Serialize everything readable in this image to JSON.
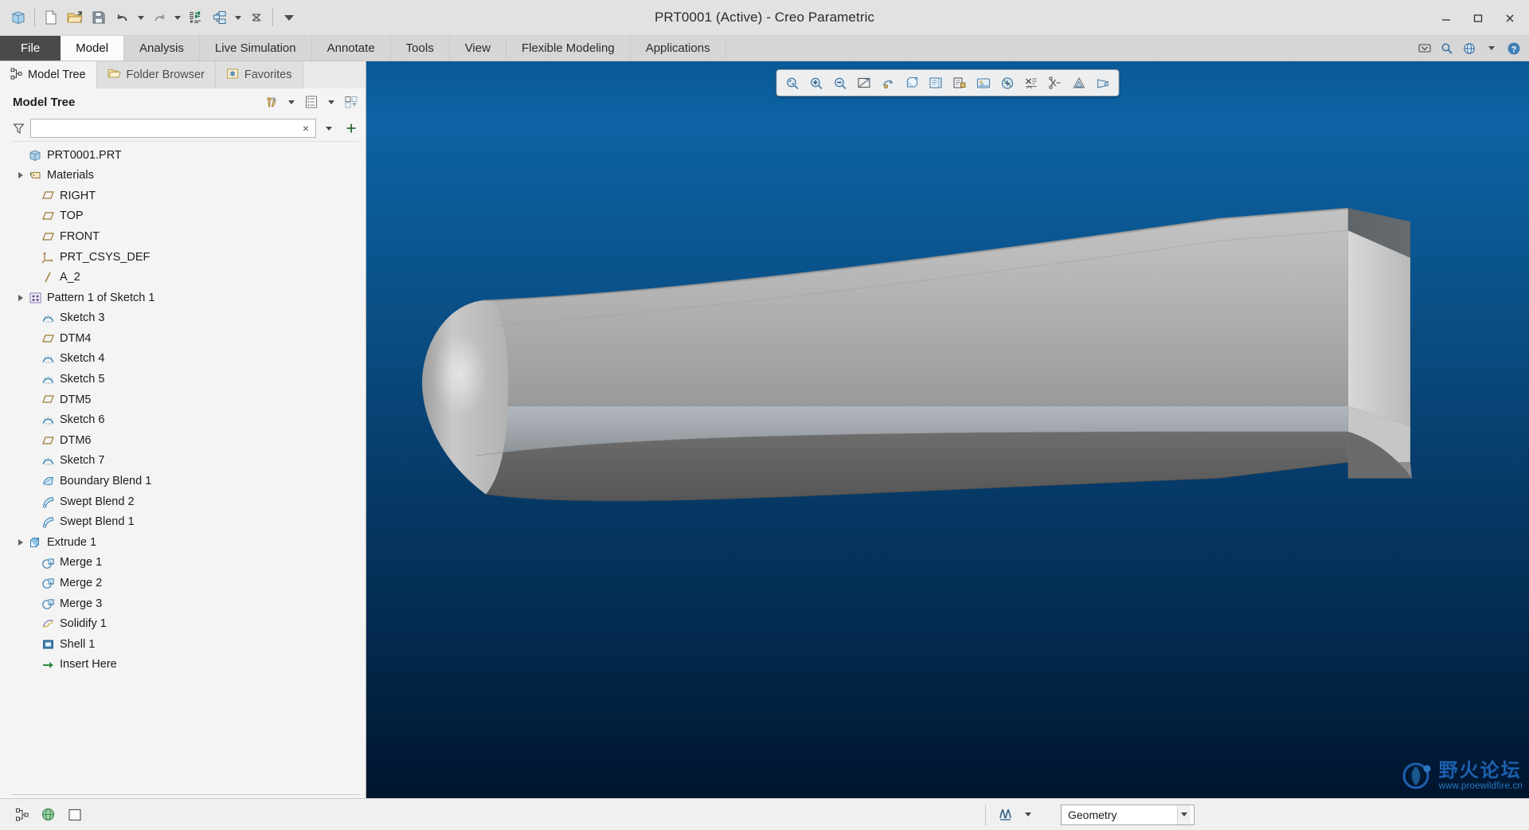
{
  "window": {
    "title": "PRT0001 (Active) - Creo Parametric",
    "minimize_label": "Minimize",
    "maximize_label": "Restore",
    "close_label": "Close"
  },
  "quick_access": {
    "items": [
      {
        "name": "app-icon",
        "label": "Creo Parametric"
      },
      {
        "name": "new-icon",
        "label": "New"
      },
      {
        "name": "open-icon",
        "label": "Open"
      },
      {
        "name": "save-icon",
        "label": "Save"
      },
      {
        "name": "undo-icon",
        "label": "Undo"
      },
      {
        "name": "redo-icon",
        "label": "Redo"
      },
      {
        "name": "regenerate-icon",
        "label": "Regenerate"
      },
      {
        "name": "window-switch-icon",
        "label": "Close Window"
      },
      {
        "name": "close-window-icon",
        "label": "Close"
      },
      {
        "name": "customize-icon",
        "label": "Customize Quick Access Toolbar"
      }
    ]
  },
  "ribbon": {
    "tabs": [
      {
        "label": "File",
        "active": false,
        "file": true
      },
      {
        "label": "Model",
        "active": true,
        "file": false
      },
      {
        "label": "Analysis",
        "active": false,
        "file": false
      },
      {
        "label": "Live Simulation",
        "active": false,
        "file": false
      },
      {
        "label": "Annotate",
        "active": false,
        "file": false
      },
      {
        "label": "Tools",
        "active": false,
        "file": false
      },
      {
        "label": "View",
        "active": false,
        "file": false
      },
      {
        "label": "Flexible Modeling",
        "active": false,
        "file": false
      },
      {
        "label": "Applications",
        "active": false,
        "file": false
      }
    ],
    "right_buttons": [
      {
        "name": "minimize-ribbon-icon",
        "label": "Minimize the Ribbon"
      },
      {
        "name": "search-icon",
        "label": "Search"
      },
      {
        "name": "help-center-icon",
        "label": "Help Center"
      },
      {
        "name": "help-dropdown-icon",
        "label": "Help Options"
      },
      {
        "name": "help-icon",
        "label": "Help"
      }
    ]
  },
  "navigator": {
    "tabs": [
      {
        "label": "Model Tree",
        "icon": "model-tree-icon",
        "active": true
      },
      {
        "label": "Folder Browser",
        "icon": "folder-browser-icon",
        "active": false
      },
      {
        "label": "Favorites",
        "icon": "favorites-icon",
        "active": false
      }
    ],
    "panel_title": "Model Tree",
    "tool_buttons": [
      {
        "name": "settings-tools-icon",
        "label": "Settings"
      },
      {
        "name": "settings-dropdown-icon",
        "label": "Settings Menu"
      },
      {
        "name": "tree-columns-icon",
        "label": "Show Tree Columns"
      },
      {
        "name": "tree-columns-dropdown-icon",
        "label": "Tree Columns Menu"
      },
      {
        "name": "tree-filters-icon",
        "label": "Tree Filters"
      }
    ],
    "filter": {
      "value": "",
      "placeholder": "",
      "clear_label": "×",
      "funnel_icon": "filter-funnel-icon",
      "dropdown_label": "Search Options",
      "add_label": "+"
    },
    "tree": [
      {
        "label": "PRT0001.PRT",
        "icon": "part-icon",
        "indent": 0,
        "expandable": false
      },
      {
        "label": "Materials",
        "icon": "materials-icon",
        "indent": 0,
        "expandable": true
      },
      {
        "label": "RIGHT",
        "icon": "datum-plane-icon",
        "indent": 1,
        "expandable": false
      },
      {
        "label": "TOP",
        "icon": "datum-plane-icon",
        "indent": 1,
        "expandable": false
      },
      {
        "label": "FRONT",
        "icon": "datum-plane-icon",
        "indent": 1,
        "expandable": false
      },
      {
        "label": "PRT_CSYS_DEF",
        "icon": "coordinate-system-icon",
        "indent": 1,
        "expandable": false
      },
      {
        "label": "A_2",
        "icon": "datum-axis-icon",
        "indent": 1,
        "expandable": false
      },
      {
        "label": "Pattern 1 of Sketch 1",
        "icon": "pattern-icon",
        "indent": 0,
        "expandable": true
      },
      {
        "label": "Sketch 3",
        "icon": "sketch-icon",
        "indent": 1,
        "expandable": false
      },
      {
        "label": "DTM4",
        "icon": "datum-plane-icon",
        "indent": 1,
        "expandable": false
      },
      {
        "label": "Sketch 4",
        "icon": "sketch-icon",
        "indent": 1,
        "expandable": false
      },
      {
        "label": "Sketch 5",
        "icon": "sketch-icon",
        "indent": 1,
        "expandable": false
      },
      {
        "label": "DTM5",
        "icon": "datum-plane-icon",
        "indent": 1,
        "expandable": false
      },
      {
        "label": "Sketch 6",
        "icon": "sketch-icon",
        "indent": 1,
        "expandable": false
      },
      {
        "label": "DTM6",
        "icon": "datum-plane-icon",
        "indent": 1,
        "expandable": false
      },
      {
        "label": "Sketch 7",
        "icon": "sketch-icon",
        "indent": 1,
        "expandable": false
      },
      {
        "label": "Boundary Blend 1",
        "icon": "boundary-blend-icon",
        "indent": 1,
        "expandable": false
      },
      {
        "label": "Swept Blend 2",
        "icon": "swept-blend-icon",
        "indent": 1,
        "expandable": false
      },
      {
        "label": "Swept Blend 1",
        "icon": "swept-blend-icon",
        "indent": 1,
        "expandable": false
      },
      {
        "label": "Extrude 1",
        "icon": "extrude-icon",
        "indent": 0,
        "expandable": true
      },
      {
        "label": "Merge 1",
        "icon": "merge-icon",
        "indent": 1,
        "expandable": false
      },
      {
        "label": "Merge 2",
        "icon": "merge-icon",
        "indent": 1,
        "expandable": false
      },
      {
        "label": "Merge 3",
        "icon": "merge-icon",
        "indent": 1,
        "expandable": false
      },
      {
        "label": "Solidify 1",
        "icon": "solidify-icon",
        "indent": 1,
        "expandable": false
      },
      {
        "label": "Shell 1",
        "icon": "shell-icon",
        "indent": 1,
        "expandable": false
      },
      {
        "label": "Insert Here",
        "icon": "insert-here-icon",
        "indent": 1,
        "expandable": false
      }
    ]
  },
  "graphics": {
    "toolbar": [
      {
        "name": "refit-icon",
        "label": "Refit"
      },
      {
        "name": "zoom-in-icon",
        "label": "Zoom In"
      },
      {
        "name": "zoom-out-icon",
        "label": "Zoom Out"
      },
      {
        "name": "repaint-icon",
        "label": "Repaint"
      },
      {
        "name": "spin-center-icon",
        "label": "Spin Center"
      },
      {
        "name": "display-style-icon",
        "label": "Display Style"
      },
      {
        "name": "saved-orientations-icon",
        "label": "Saved Orientations"
      },
      {
        "name": "view-manager-icon",
        "label": "View Manager"
      },
      {
        "name": "scene-icon",
        "label": "Scene"
      },
      {
        "name": "datum-display-icon",
        "label": "Datum Display Filters"
      },
      {
        "name": "annotation-display-icon",
        "label": "Annotation Display"
      },
      {
        "name": "spin-cut-icon",
        "label": "Spin Cut"
      },
      {
        "name": "appearance-gallery-icon",
        "label": "Appearance Gallery"
      },
      {
        "name": "perspective-view-icon",
        "label": "Perspective View"
      }
    ],
    "background_top_color": "#0c63a4",
    "background_bottom_color": "#00152e",
    "model_light_color": "#adadad",
    "model_dark_color": "#595959"
  },
  "watermark": {
    "chinese_text": "野火论坛",
    "url_text": "www.proewildfire.cn"
  },
  "statusbar": {
    "left_buttons": [
      {
        "name": "model-tree-toggle-icon",
        "label": "Show/Hide Navigator"
      },
      {
        "name": "browser-toggle-icon",
        "label": "Show/Hide Web Browser"
      },
      {
        "name": "full-screen-icon",
        "label": "Full Screen"
      }
    ],
    "mid_buttons": [
      {
        "name": "selection-tool-icon",
        "label": "Selection Tool"
      },
      {
        "name": "selection-dropdown-icon",
        "label": "Selection Options"
      }
    ],
    "selection_filter": {
      "value": "Geometry",
      "dropdown_label": "Selection Filter"
    }
  }
}
